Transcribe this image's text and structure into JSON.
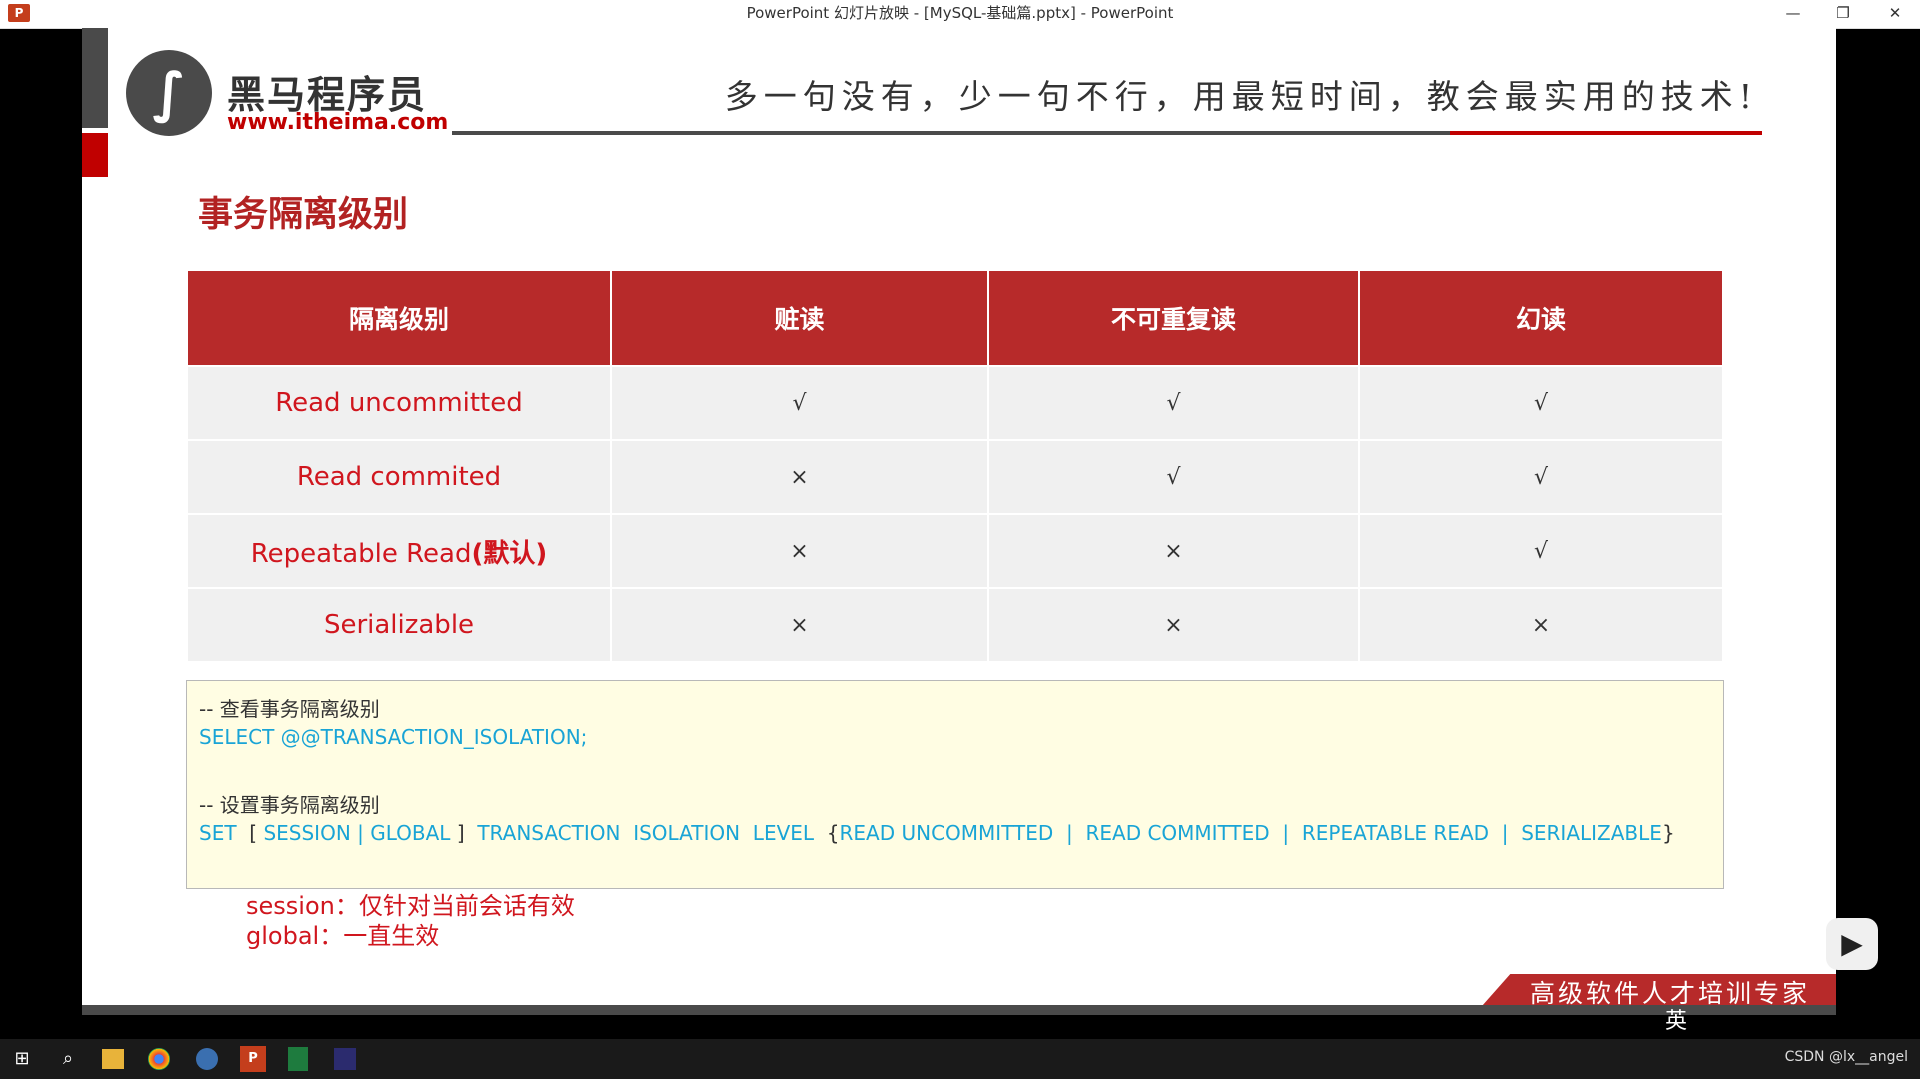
{
  "window": {
    "app_icon": "P",
    "title": "PowerPoint 幻灯片放映 - [MySQL-基础篇.pptx] - PowerPoint",
    "minimize": "—",
    "restore": "❐",
    "close": "✕"
  },
  "header": {
    "logo_mark": "∫",
    "logo_cn": "黑马程序员",
    "logo_url": "www.itheima.com",
    "slogan": "多一句没有，少一句不行，用最短时间，教会最实用的技术!"
  },
  "slide_title": "事务隔离级别",
  "table": {
    "headers": [
      "隔离级别",
      "赃读",
      "不可重复读",
      "幻读"
    ],
    "rows": [
      {
        "level": "Read uncommitted",
        "level_bold": "",
        "dirty": "√",
        "nonrepeat": "√",
        "phantom": "√"
      },
      {
        "level": "Read commited",
        "level_bold": "",
        "dirty": "×",
        "nonrepeat": "√",
        "phantom": "√"
      },
      {
        "level": "Repeatable Read",
        "level_bold": "(默认)",
        "dirty": "×",
        "nonrepeat": "×",
        "phantom": "√"
      },
      {
        "level": "Serializable",
        "level_bold": "",
        "dirty": "×",
        "nonrepeat": "×",
        "phantom": "×"
      }
    ]
  },
  "code": {
    "comment1": "-- 查看事务隔离级别",
    "select_stmt": "SELECT @@TRANSACTION_ISOLATION;",
    "comment2": "-- 设置事务隔离级别",
    "set_kw": "SET",
    "set_bracket_open": "[",
    "set_scope": "SESSION | GLOBAL",
    "set_bracket_close": "]",
    "set_transaction": "TRANSACTION",
    "set_isolation": "ISOLATION",
    "set_level": "LEVEL",
    "set_brace_open": "{",
    "set_options": "READ UNCOMMITTED  |  READ COMMITTED  |  REPEATABLE READ  |  SERIALIZABLE",
    "set_brace_close": "}"
  },
  "notes": {
    "session": "session：仅针对当前会话有效",
    "global": "global：一直生效"
  },
  "footer": {
    "slogan": "高级软件人才培训专家"
  },
  "overlay": {
    "play_icon": "▶",
    "ime_lang": "英"
  },
  "taskbar": {
    "start_icon": "⊞",
    "search_icon": "⌕",
    "tray_text": "CSDN @lx__angel"
  }
}
